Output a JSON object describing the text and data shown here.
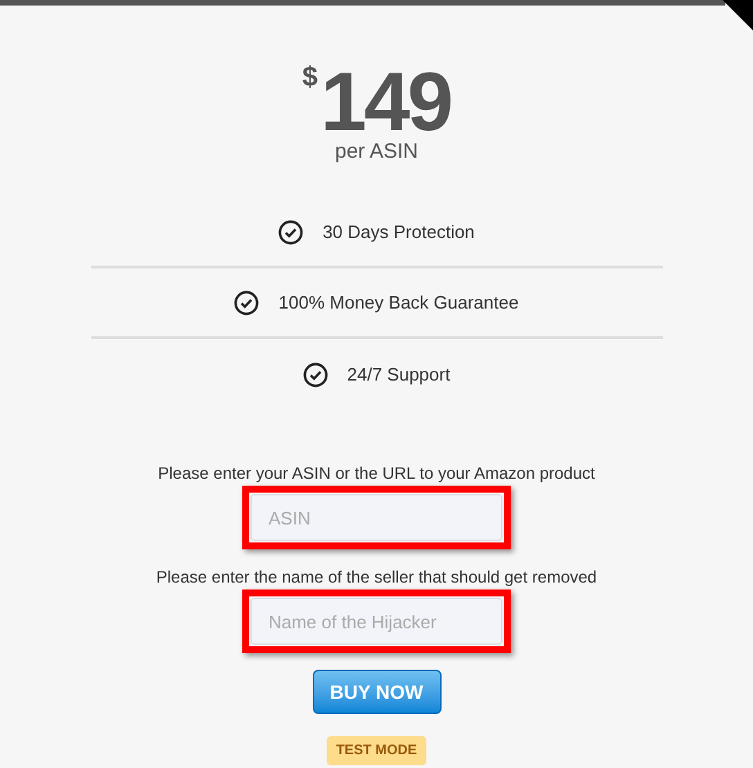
{
  "price": {
    "currency": "$",
    "amount": "149",
    "unit": "per ASIN"
  },
  "features": [
    {
      "label": "30 Days Protection"
    },
    {
      "label": "100% Money Back Guarantee"
    },
    {
      "label": "24/7 Support"
    }
  ],
  "fields": [
    {
      "label": "Please enter your ASIN or the URL to your Amazon product",
      "placeholder": "ASIN",
      "highlighted": true
    },
    {
      "label": "Please enter the name of the seller that should get removed",
      "placeholder": "Name of the Hijacker",
      "highlighted": true
    }
  ],
  "buy_button": "BUY NOW",
  "badge": "TEST MODE"
}
